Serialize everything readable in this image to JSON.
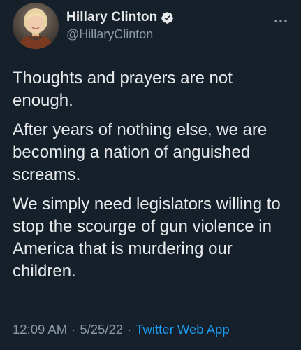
{
  "author": {
    "display_name": "Hillary Clinton",
    "handle": "@HillaryClinton",
    "verified": true,
    "avatar_icon": "profile-photo"
  },
  "tweet": {
    "paragraphs": [
      "Thoughts and prayers are not enough.",
      "After years of nothing else, we are becoming a nation of anguished screams.",
      "We simply need legislators willing to stop the scourge of gun violence in America that is murdering our children."
    ]
  },
  "meta": {
    "time": "12:09 AM",
    "separator": "·",
    "date": "5/25/22",
    "source": "Twitter Web App"
  },
  "colors": {
    "background": "#15202b",
    "text": "#e7e9ea",
    "secondary_text": "#8b98a5",
    "accent": "#1d9bf0"
  },
  "icons": {
    "verified": "verified-badge-icon",
    "more": "more-options-icon"
  }
}
